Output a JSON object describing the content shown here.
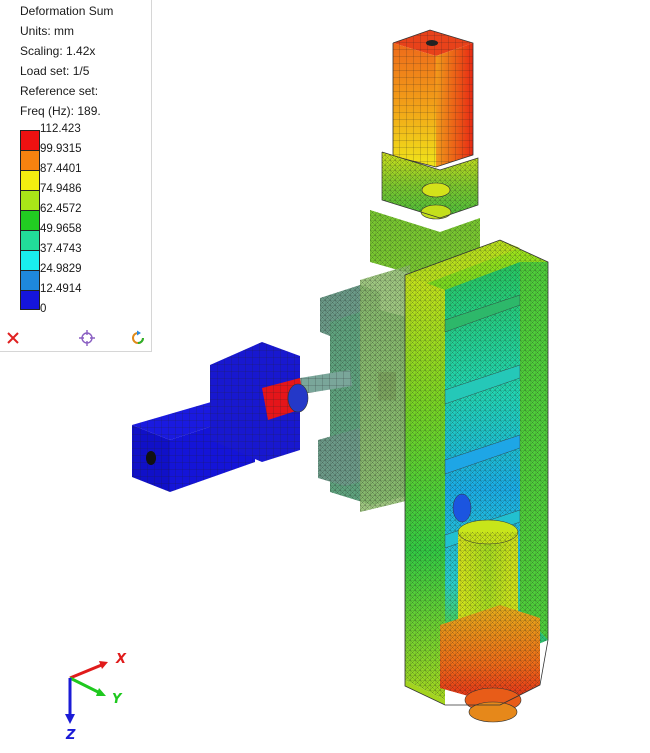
{
  "legend": {
    "title": "Deformation Sum",
    "units_label": "Units:",
    "units_value": "mm",
    "scaling_label": "Scaling:",
    "scaling_value": "1.42x",
    "load_set_label": "Load set:",
    "load_set_value": "1/5",
    "reference_set_label": "Reference set:",
    "freq_label": "Freq (Hz):",
    "freq_value": "189.",
    "scale": [
      {
        "value": "112.423",
        "color": "#ee1111"
      },
      {
        "value": "99.9315",
        "color": "#f7820f"
      },
      {
        "value": "87.4401",
        "color": "#f4ee10"
      },
      {
        "value": "74.9486",
        "color": "#a9e618"
      },
      {
        "value": "62.4572",
        "color": "#22cc22"
      },
      {
        "value": "49.9658",
        "color": "#22dd99"
      },
      {
        "value": "37.4743",
        "color": "#19eeee"
      },
      {
        "value": "24.9829",
        "color": "#1e88dd"
      },
      {
        "value": "12.4914",
        "color": "#1515dd"
      },
      {
        "value": "0",
        "color": ""
      }
    ]
  },
  "toolbar": {
    "close_icon": "close-icon",
    "target_icon": "crosshair-icon",
    "refresh_icon": "refresh-icon"
  },
  "triad": {
    "x_label": "X",
    "y_label": "Y",
    "z_label": "Z",
    "x_color": "#e01b1b",
    "y_color": "#1ec81e",
    "z_color": "#1b1bd6"
  }
}
